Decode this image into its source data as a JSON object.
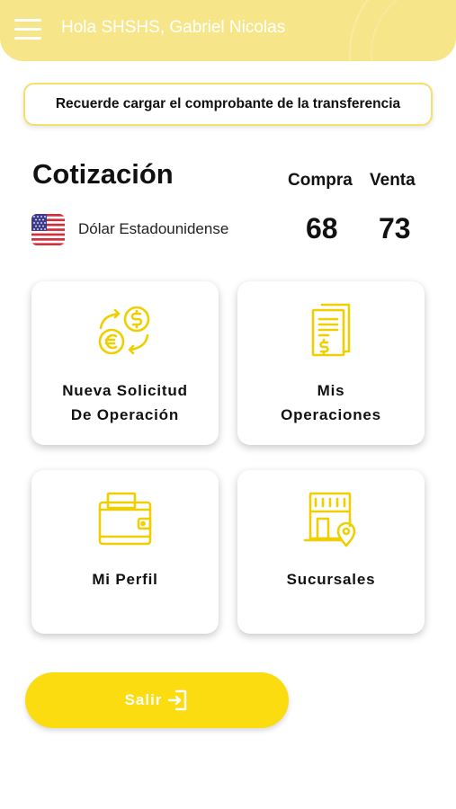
{
  "header": {
    "greeting": "Hola SHSHS, Gabriel Nicolas",
    "menu_icon": "hamburger-menu-icon"
  },
  "notice": {
    "text": "Recuerde cargar el comprobante de la transferencia"
  },
  "quote": {
    "title": "Cotización",
    "buy_header": "Compra",
    "sell_header": "Venta",
    "currency": {
      "name": "Dólar Estadounidense",
      "flag_icon": "us-flag-icon",
      "buy": "68",
      "sell": "73"
    }
  },
  "menu": {
    "new_request": {
      "line1": "Nueva Solicitud",
      "line2": "De Operación",
      "icon": "currency-exchange-icon"
    },
    "my_operations": {
      "line1": "Mis",
      "line2": "Operaciones",
      "icon": "document-money-icon"
    },
    "my_profile": {
      "label": "Mi Perfil",
      "icon": "wallet-icon"
    },
    "branches": {
      "label": "Sucursales",
      "icon": "store-location-icon"
    }
  },
  "exit": {
    "label": "Salir",
    "icon": "logout-icon"
  },
  "colors": {
    "accent": "#f5d800",
    "header_bg": "#f7e58a",
    "button": "#fbdc10",
    "icon": "#f0cf00"
  }
}
